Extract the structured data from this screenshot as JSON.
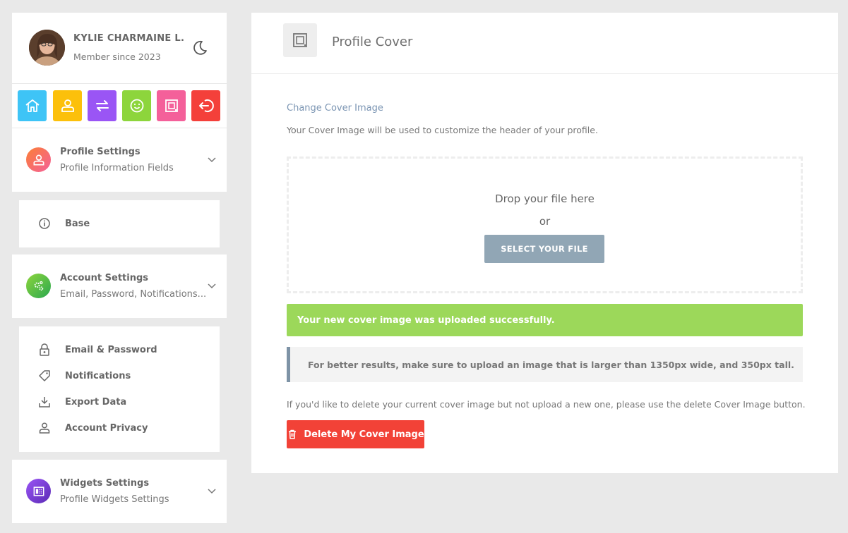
{
  "user": {
    "name": "KYLIE CHARMAINE L.",
    "member_since": "Member since 2023"
  },
  "theme_toggle": {
    "icon": "moon-icon"
  },
  "quick_actions": [
    {
      "name": "home",
      "icon": "home-icon",
      "color": "#3ec4f6"
    },
    {
      "name": "profile",
      "icon": "user-icon",
      "color": "#fcc00b"
    },
    {
      "name": "exchange",
      "icon": "exchange-icon",
      "color": "#9a55f5"
    },
    {
      "name": "smile",
      "icon": "smile-icon",
      "color": "#8dd53c"
    },
    {
      "name": "cover",
      "icon": "cover-image-icon",
      "color": "#f4609a"
    },
    {
      "name": "logout",
      "icon": "logout-icon",
      "color": "#f4403a"
    }
  ],
  "sidebar": {
    "profile_settings": {
      "title": "Profile Settings",
      "subtitle": "Profile Information Fields",
      "items": [
        {
          "label": "Base",
          "icon": "info-icon"
        }
      ]
    },
    "account_settings": {
      "title": "Account Settings",
      "subtitle": "Email, Password, Notifications...",
      "items": [
        {
          "label": "Email & Password",
          "icon": "lock-icon"
        },
        {
          "label": "Notifications",
          "icon": "tag-icon"
        },
        {
          "label": "Export Data",
          "icon": "download-icon"
        },
        {
          "label": "Account Privacy",
          "icon": "user-icon"
        }
      ]
    },
    "widgets_settings": {
      "title": "Widgets Settings",
      "subtitle": "Profile Widgets Settings"
    }
  },
  "main": {
    "header_title": "Profile Cover",
    "change_label": "Change Cover Image",
    "change_desc": "Your Cover Image will be used to customize the header of your profile.",
    "dropzone": {
      "text": "Drop your file here",
      "or": "or",
      "button": "SELECT YOUR FILE"
    },
    "success_message": "Your new cover image was uploaded successfully.",
    "info_message": "For better results, make sure to upload an image that is larger than 1350px wide, and 350px tall.",
    "delete_note": "If you'd like to delete your current cover image but not upload a new one, please use the delete Cover Image button.",
    "delete_button": "Delete My Cover Image"
  },
  "colors": {
    "success": "#9cd85a",
    "danger": "#f24237",
    "select_button": "#91a6b5",
    "accent_link": "#7b95b3"
  }
}
